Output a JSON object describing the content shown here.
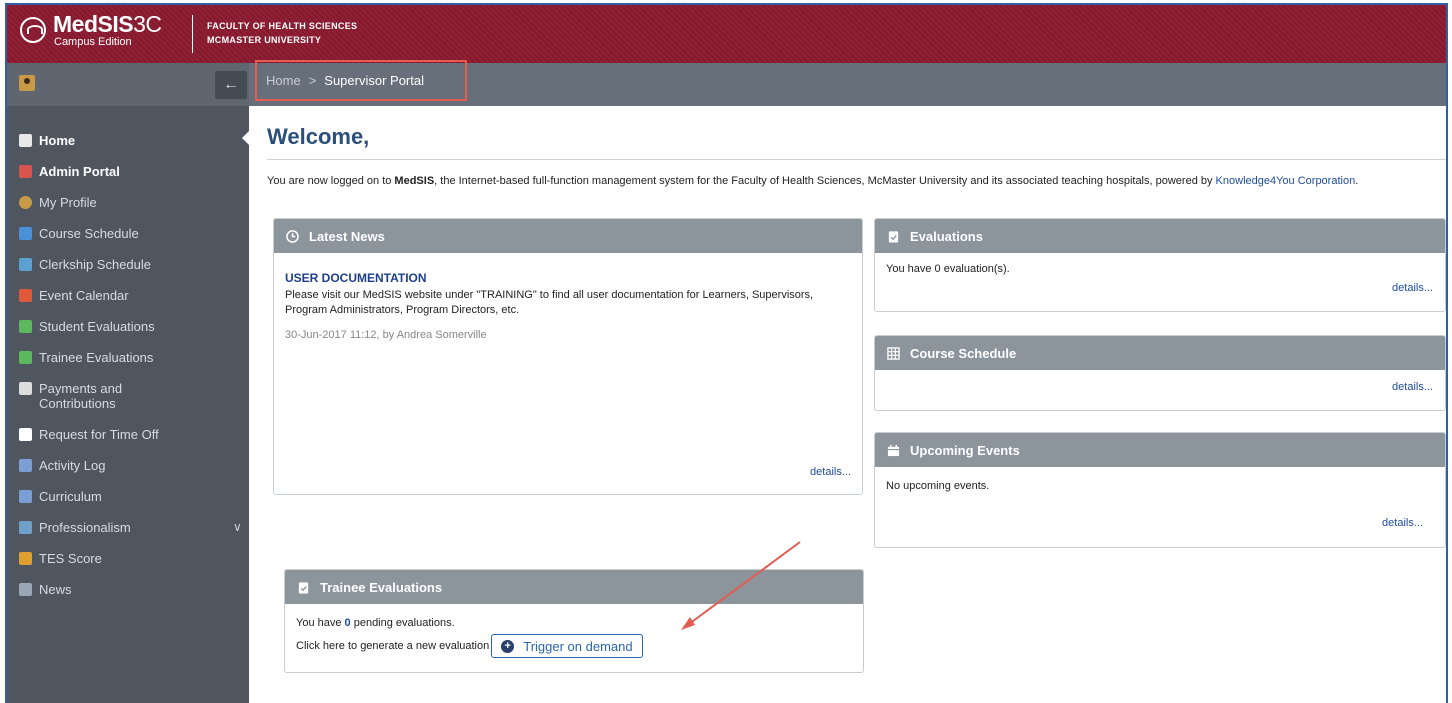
{
  "header": {
    "app_name": "MedSIS",
    "app_version": "3C",
    "edition": "Campus Edition",
    "faculty_line1": "FACULTY OF HEALTH SCIENCES",
    "faculty_line2": "MCMASTER UNIVERSITY",
    "brand_color": "#8a1a30"
  },
  "breadcrumb": {
    "home": "Home",
    "separator": ">",
    "current": "Supervisor Portal"
  },
  "sidebar": {
    "items": [
      {
        "label": "Home",
        "icon": "home-icon",
        "color": "#e8e8e8"
      },
      {
        "label": "Admin Portal",
        "icon": "admin-icon",
        "color": "#d9534f"
      },
      {
        "label": "My Profile",
        "icon": "person-icon",
        "color": "#c89a45"
      },
      {
        "label": "Course Schedule",
        "icon": "course-icon",
        "color": "#4a90d9"
      },
      {
        "label": "Clerkship Schedule",
        "icon": "clerkship-icon",
        "color": "#5aa0d0"
      },
      {
        "label": "Event Calendar",
        "icon": "calendar-icon",
        "color": "#e05a3a"
      },
      {
        "label": "Student Evaluations",
        "icon": "evaluation-icon",
        "color": "#5cb85c"
      },
      {
        "label": "Trainee Evaluations",
        "icon": "evaluation-icon",
        "color": "#5cb85c"
      },
      {
        "label": "Payments and Contributions",
        "icon": "payments-icon",
        "color": "#dddddd"
      },
      {
        "label": "Request for Time Off",
        "icon": "calendar-icon",
        "color": "#ffffff"
      },
      {
        "label": "Activity Log",
        "icon": "log-icon",
        "color": "#7b9fd4"
      },
      {
        "label": "Curriculum",
        "icon": "curriculum-icon",
        "color": "#7b9fd4"
      },
      {
        "label": "Professionalism",
        "icon": "professionalism-icon",
        "color": "#6fa0c8"
      },
      {
        "label": "TES Score",
        "icon": "score-icon",
        "color": "#e0a030"
      },
      {
        "label": "News",
        "icon": "news-icon",
        "color": "#9aa5b5"
      }
    ]
  },
  "main": {
    "welcome": "Welcome,",
    "intro_prefix": "You are now logged on to ",
    "intro_brand": "MedSIS",
    "intro_middle": ", the Internet-based full-function management system for the Faculty of Health Sciences, McMaster University and its associated teaching hospitals, powered by ",
    "intro_link": "Knowledge4You Corporation",
    "intro_suffix": "."
  },
  "panels": {
    "latest_news": {
      "title": "Latest News",
      "item_title": "USER DOCUMENTATION",
      "item_text": "Please visit our MedSIS website under \"TRAINING\" to find all user documentation for Learners, Supervisors, Program Administrators, Program Directors, etc.",
      "item_meta": "30-Jun-2017 11:12, by Andrea Somerville",
      "details": "details..."
    },
    "evaluations": {
      "title": "Evaluations",
      "text": "You have 0 evaluation(s).",
      "details": "details..."
    },
    "course_schedule": {
      "title": "Course Schedule",
      "details": "details..."
    },
    "upcoming_events": {
      "title": "Upcoming Events",
      "text": "No upcoming events.",
      "details": "details..."
    },
    "trainee_evaluations": {
      "title": "Trainee Evaluations",
      "pending_prefix": "You have ",
      "pending_count": "0",
      "pending_suffix": " pending evaluations.",
      "generate_text": "Click here to generate a new evaluation",
      "trigger_label": "Trigger on demand"
    }
  },
  "colors": {
    "panel_header": "#8c949c",
    "link": "#1f4d9a",
    "annotation": "#e35d52"
  }
}
